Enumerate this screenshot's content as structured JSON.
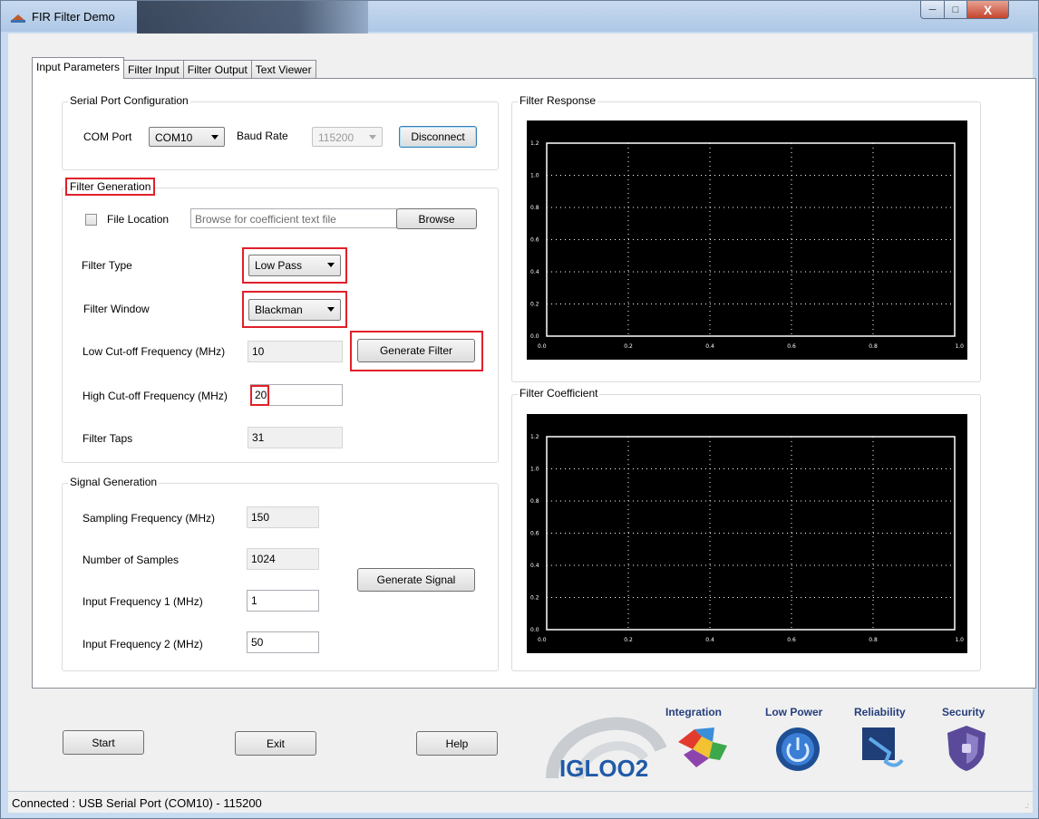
{
  "window": {
    "title": "FIR Filter Demo"
  },
  "tabs": [
    "Input Parameters",
    "Filter Input",
    "Filter Output",
    "Text Viewer"
  ],
  "serial": {
    "group_title": "Serial Port Configuration",
    "com_label": "COM Port",
    "com_value": "COM10",
    "baud_label": "Baud Rate",
    "baud_value": "115200",
    "disconnect": "Disconnect"
  },
  "filter_gen": {
    "group_title": "Filter Generation",
    "file_location_label": "File Location",
    "file_placeholder": "Browse for coefficient text file",
    "browse": "Browse",
    "type_label": "Filter Type",
    "type_value": "Low Pass",
    "window_label": "Filter Window",
    "window_value": "Blackman",
    "low_cut_label": "Low Cut-off Frequency (MHz)",
    "low_cut_value": "10",
    "generate_filter": "Generate Filter",
    "high_cut_label": "High Cut-off Frequency (MHz)",
    "high_cut_value": "20",
    "taps_label": "Filter Taps",
    "taps_value": "31"
  },
  "signal_gen": {
    "group_title": "Signal Generation",
    "sampling_label": "Sampling Frequency (MHz)",
    "sampling_value": "150",
    "samples_label": "Number of Samples",
    "samples_value": "1024",
    "generate_signal": "Generate Signal",
    "input1_label": "Input Frequency 1 (MHz)",
    "input1_value": "1",
    "input2_label": "Input Frequency 2 (MHz)",
    "input2_value": "50"
  },
  "response": {
    "group_title": "Filter Response"
  },
  "coefficient": {
    "group_title": "Filter Coefficient"
  },
  "buttons": {
    "start": "Start",
    "exit": "Exit",
    "help": "Help"
  },
  "branding": {
    "logo": "IGLOO2",
    "features": [
      "Integration",
      "Low Power",
      "Reliability",
      "Security"
    ]
  },
  "status": "Connected : USB Serial Port (COM10) - 115200",
  "chart_data": [
    {
      "type": "line",
      "title": "",
      "x_ticks": [
        "0.0",
        "0.2",
        "0.4",
        "0.6",
        "0.8",
        "1.0"
      ],
      "y_ticks": [
        "0.0",
        "0.2",
        "0.4",
        "0.6",
        "0.8",
        "1.0",
        "1.2"
      ],
      "xlim": [
        0,
        1
      ],
      "ylim": [
        0,
        1.2
      ],
      "grid": true,
      "series": []
    },
    {
      "type": "line",
      "title": "",
      "x_ticks": [
        "0.0",
        "0.2",
        "0.4",
        "0.6",
        "0.8",
        "1.0"
      ],
      "y_ticks": [
        "0.0",
        "0.2",
        "0.4",
        "0.6",
        "0.8",
        "1.0",
        "1.2"
      ],
      "xlim": [
        0,
        1
      ],
      "ylim": [
        0,
        1.2
      ],
      "grid": true,
      "series": []
    }
  ],
  "colors": {
    "highlight": "#e0202a",
    "brand": "#253f7c",
    "chart_bg": "#000000"
  }
}
